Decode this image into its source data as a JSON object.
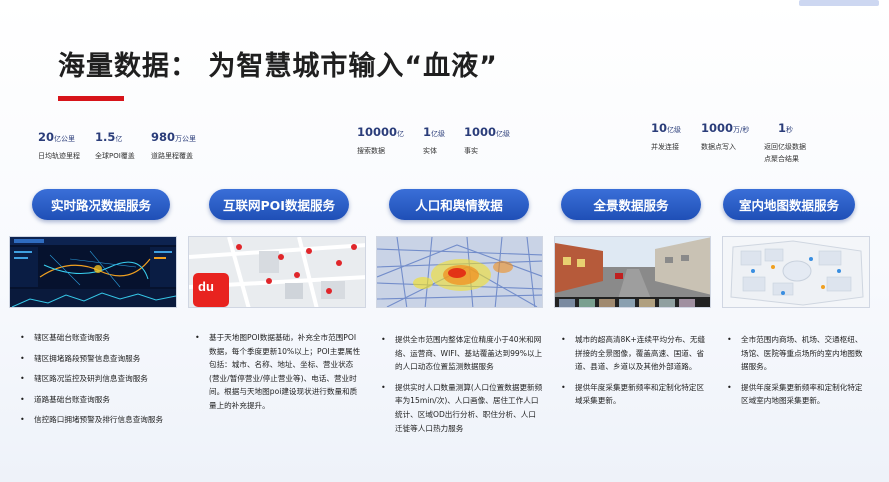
{
  "header": {
    "title": "海量数据： 为智慧城市输入“血液”"
  },
  "stats": {
    "group1": [
      {
        "num": "20",
        "unit": "亿公里",
        "label": "日均轨迹里程"
      },
      {
        "num": "1.5",
        "unit": "亿",
        "label": "全球POI覆盖"
      },
      {
        "num": "980",
        "unit": "万公里",
        "label": "道路里程覆盖"
      }
    ],
    "group2": [
      {
        "num": "10000",
        "unit": "亿",
        "label": "搜索数据"
      },
      {
        "num": "1",
        "unit": "亿级",
        "label": "实体"
      },
      {
        "num": "1000",
        "unit": "亿级",
        "label": "事实"
      }
    ],
    "group3": [
      {
        "num": "10",
        "unit": "亿级",
        "label": "并发连接"
      },
      {
        "num": "1000",
        "unit": "万/秒",
        "label": "数据点写入"
      },
      {
        "num": "1",
        "unit": "秒",
        "label": "返回亿级数据"
      },
      {
        "label2": "点聚合结果"
      }
    ]
  },
  "services": [
    {
      "label": "实时路况数据服务"
    },
    {
      "label": "互联网POI数据服务"
    },
    {
      "label": "人口和舆情数据"
    },
    {
      "label": "全景数据服务"
    },
    {
      "label": "室内地图数据服务"
    }
  ],
  "panels": {
    "poi_logo_text": "du"
  },
  "columns": {
    "col1": [
      "辖区基础台账查询服务",
      "辖区拥堵路段预警信息查询服务",
      "辖区路况监控及研判信息查询服务",
      "道路基础台账查询服务",
      "信控路口拥堵预警及排行信息查询服务"
    ],
    "col2": [
      "基于天地图POI数据基础，补充全市范围POI数据，每个季度更新10%以上；POI主要属性包括：城市、名称、地址、坐标、营业状态(营业/暂停营业/停止营业等)、电话、营业时间。根据与天地图poi建设现状进行数量和质量上的补充提升。"
    ],
    "col3": [
      "提供全市范围内整体定位精度小于40米和网络、运营商、WIFI、基站覆盖达到99%以上的人口动态位置监测数据服务",
      "提供实时人口数量测算(人口位置数据更新频率为15min/次)、人口画像、居住工作人口统计、区域OD出行分析、职住分析、人口迁徙等人口热力服务"
    ],
    "col4": [
      "城市的超高清8K+连续平均分布、无缝拼接的全景图像，覆盖高速、国道、省道、县道、乡道以及其他外部道路。",
      "提供年度采集更新频率和定制化特定区域采集更新。"
    ],
    "col5": [
      "全市范围内商场、机场、交通枢纽、场馆、医院等重点场所的室内地图数据服务。",
      "提供年度采集更新频率和定制化特定区域室内地图采集更新。"
    ]
  },
  "colors": {
    "accent_red": "#d7141a",
    "button_blue": "#2a5cc6",
    "stat_blue": "#2b3d7a"
  }
}
